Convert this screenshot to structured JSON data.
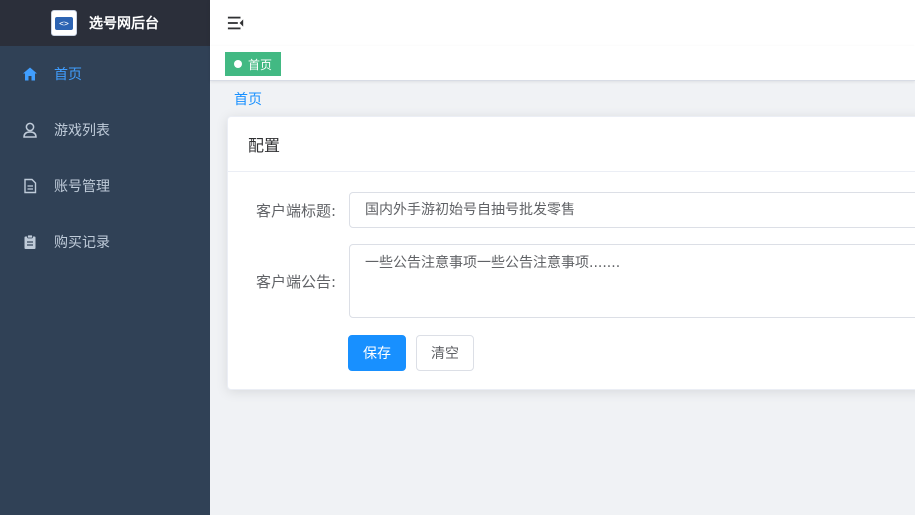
{
  "sidebar": {
    "title": "选号网后台",
    "logo_glyph": "<>",
    "items": [
      {
        "label": "首页",
        "icon": "home-icon"
      },
      {
        "label": "游戏列表",
        "icon": "user-icon"
      },
      {
        "label": "账号管理",
        "icon": "document-icon"
      },
      {
        "label": "购买记录",
        "icon": "clipboard-icon"
      }
    ],
    "active_color": "#409eff"
  },
  "tags": [
    {
      "label": "首页",
      "color": "#42b983"
    }
  ],
  "breadcrumb": {
    "current": "首页"
  },
  "card": {
    "title": "配置",
    "form": {
      "title_label": "客户端标题:",
      "title_value": "国内外手游初始号自抽号批发零售",
      "notice_label": "客户端公告:",
      "notice_value": "一些公告注意事项一些公告注意事项......."
    },
    "buttons": {
      "save": "保存",
      "clear": "清空"
    }
  }
}
